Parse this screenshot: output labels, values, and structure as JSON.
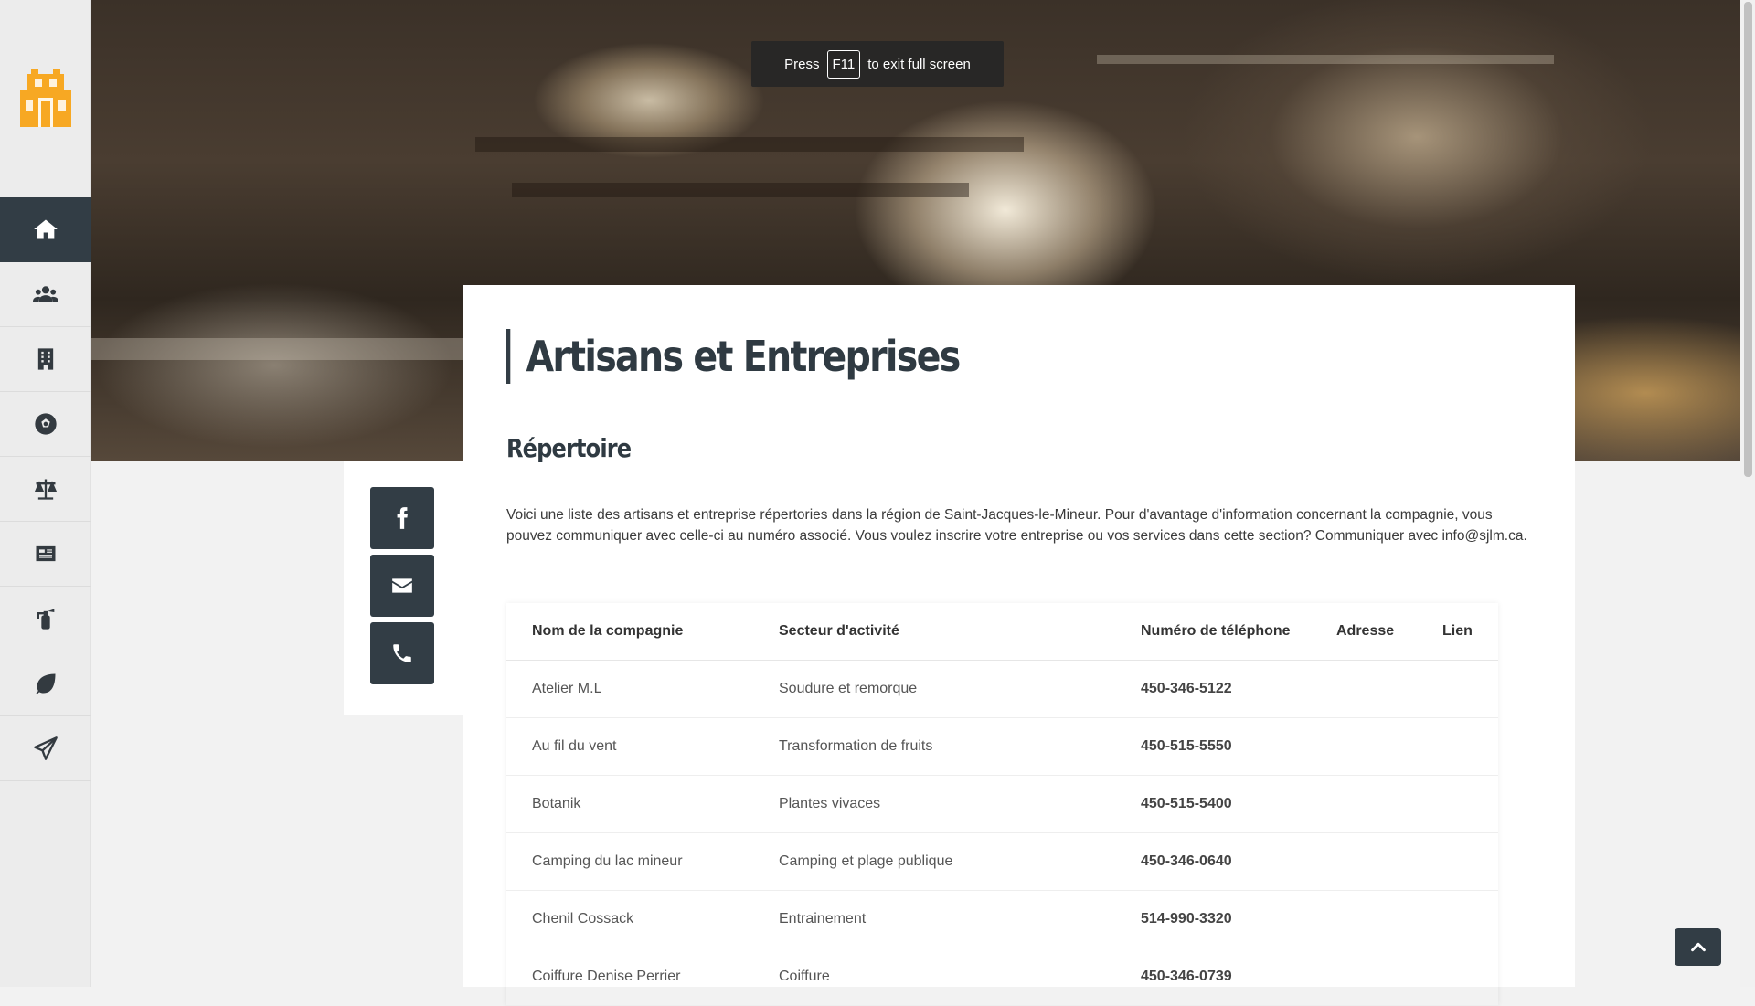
{
  "fullscreen_banner": {
    "prefix": "Press",
    "key": "F11",
    "suffix": "to exit full screen"
  },
  "sidebar": {
    "logo_icon": "house-logo-icon",
    "items": [
      {
        "icon": "home-icon",
        "active": true
      },
      {
        "icon": "users-icon",
        "active": false
      },
      {
        "icon": "building-icon",
        "active": false
      },
      {
        "icon": "soccer-ball-icon",
        "active": false
      },
      {
        "icon": "scales-icon",
        "active": false
      },
      {
        "icon": "newspaper-icon",
        "active": false
      },
      {
        "icon": "fire-extinguisher-icon",
        "active": false
      },
      {
        "icon": "leaf-icon",
        "active": false
      },
      {
        "icon": "paper-plane-icon",
        "active": false
      }
    ]
  },
  "social": [
    {
      "icon": "facebook-icon"
    },
    {
      "icon": "envelope-icon"
    },
    {
      "icon": "phone-icon"
    }
  ],
  "main": {
    "title": "Artisans et Entreprises",
    "section_title": "Répertoire",
    "intro": "Voici une liste des artisans et entreprise répertories dans la région de Saint-Jacques-le-Mineur. Pour d'avantage d'information concernant la compagnie, vous pouvez communiquer avec celle-ci au numéro associé. Vous voulez inscrire votre entreprise ou vos services dans cette section? Communiquer avec info@sjlm.ca."
  },
  "table": {
    "headers": [
      "Nom de la compagnie",
      "Secteur d'activité",
      "Numéro de téléphone",
      "Adresse",
      "Lien"
    ],
    "rows": [
      {
        "name": "Atelier M.L",
        "sector": "Soudure et remorque",
        "phone": "450-346-5122",
        "address": "",
        "link": ""
      },
      {
        "name": "Au fil du vent",
        "sector": "Transformation de fruits",
        "phone": "450-515-5550",
        "address": "",
        "link": ""
      },
      {
        "name": "Botanik",
        "sector": "Plantes vivaces",
        "phone": "450-515-5400",
        "address": "",
        "link": ""
      },
      {
        "name": "Camping du lac mineur",
        "sector": "Camping et plage publique",
        "phone": "450-346-0640",
        "address": "",
        "link": ""
      },
      {
        "name": "Chenil Cossack",
        "sector": "Entrainement",
        "phone": "514-990-3320",
        "address": "",
        "link": ""
      },
      {
        "name": "Coiffure Denise Perrier",
        "sector": "Coiffure",
        "phone": "450-346-0739",
        "address": "",
        "link": ""
      }
    ]
  },
  "back_to_top_icon": "chevron-up-icon",
  "colors": {
    "dark": "#323d45",
    "logo": "#f7a823"
  }
}
